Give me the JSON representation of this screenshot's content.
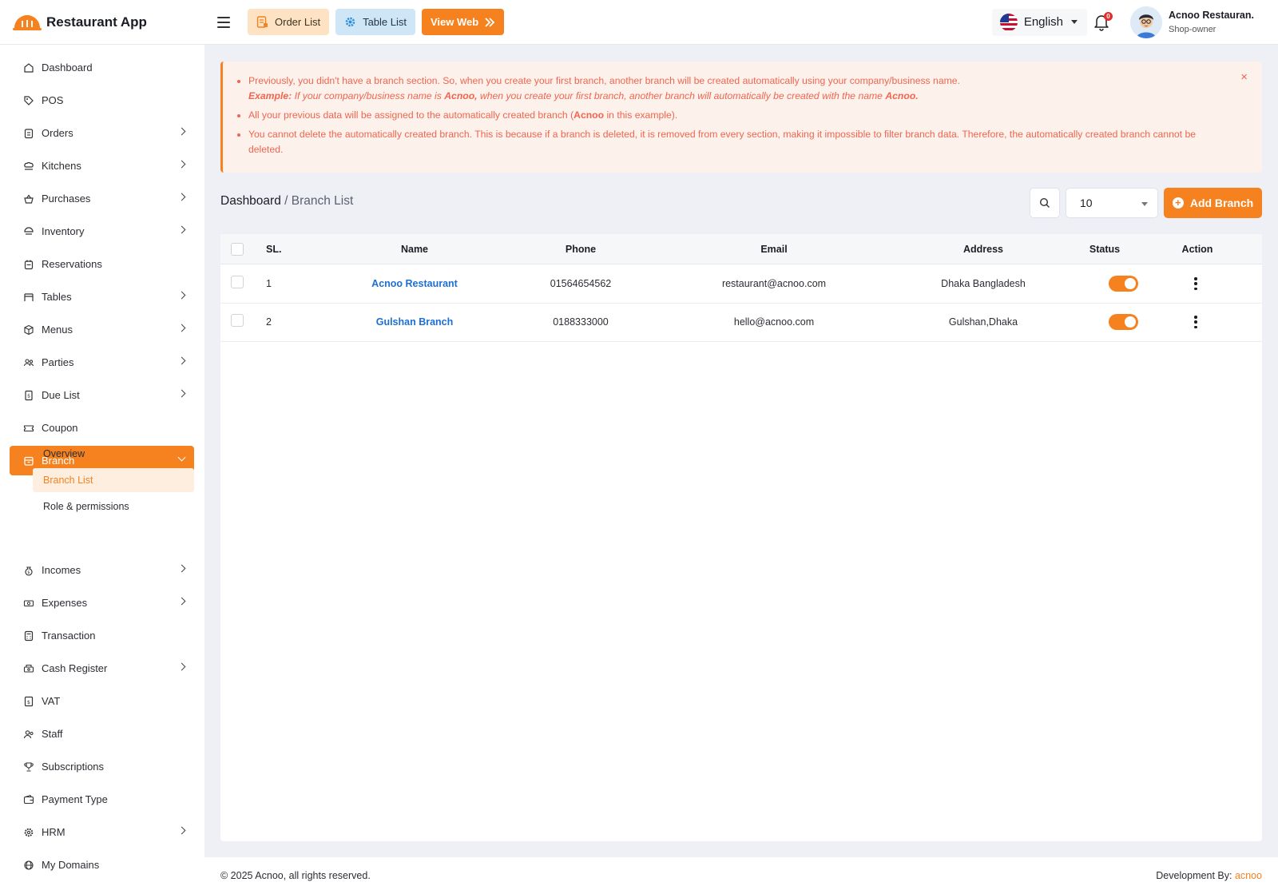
{
  "app": {
    "name": "Restaurant App"
  },
  "header": {
    "order_list": "Order List",
    "table_list": "Table List",
    "view_web": "View Web",
    "language": "English",
    "notification_count": "0",
    "profile_name": "Acnoo Restauran.",
    "profile_role": "Shop-owner"
  },
  "sidebar": {
    "items": [
      {
        "label": "Dashboard",
        "icon": "dashboard-icon",
        "chevron": false
      },
      {
        "label": "POS",
        "icon": "tag-icon",
        "chevron": false
      },
      {
        "label": "Orders",
        "icon": "clipboard-icon",
        "chevron": true
      },
      {
        "label": "Kitchens",
        "icon": "chef-hat-icon",
        "chevron": true
      },
      {
        "label": "Purchases",
        "icon": "basket-icon",
        "chevron": true
      },
      {
        "label": "Inventory",
        "icon": "inventory-icon",
        "chevron": true
      },
      {
        "label": "Reservations",
        "icon": "calendar-icon",
        "chevron": false
      },
      {
        "label": "Tables",
        "icon": "table-icon",
        "chevron": true
      },
      {
        "label": "Menus",
        "icon": "box-icon",
        "chevron": true
      },
      {
        "label": "Parties",
        "icon": "users-icon",
        "chevron": true
      },
      {
        "label": "Due List",
        "icon": "receipt-icon",
        "chevron": true
      },
      {
        "label": "Coupon",
        "icon": "ticket-icon",
        "chevron": false
      },
      {
        "label": "Branch",
        "icon": "store-icon",
        "chevron": true,
        "active": true
      }
    ],
    "branch_sub": [
      "Overview",
      "Branch List",
      "Role & permissions"
    ],
    "items_after": [
      {
        "label": "Incomes",
        "icon": "money-bag-icon",
        "chevron": true
      },
      {
        "label": "Expenses",
        "icon": "cash-icon",
        "chevron": true
      },
      {
        "label": "Transaction",
        "icon": "calculator-icon",
        "chevron": false
      },
      {
        "label": "Cash Register",
        "icon": "register-icon",
        "chevron": true
      },
      {
        "label": "VAT",
        "icon": "vat-icon",
        "chevron": false
      },
      {
        "label": "Staff",
        "icon": "staff-icon",
        "chevron": false
      },
      {
        "label": "Subscriptions",
        "icon": "trophy-icon",
        "chevron": false
      },
      {
        "label": "Payment Type",
        "icon": "wallet-icon",
        "chevron": false
      },
      {
        "label": "HRM",
        "icon": "gear-icon",
        "chevron": true
      },
      {
        "label": "My Domains",
        "icon": "globe-icon",
        "chevron": false
      }
    ]
  },
  "alert": {
    "line1": "Previously, you didn't have a branch section. So, when you create your first branch, another branch will be created automatically using your company/business name.",
    "example_label": "Example:",
    "example_pre": " If your company/business name is ",
    "example_name": "Acnoo,",
    "example_mid": " when you create your first branch, another branch will automatically be created with the name ",
    "example_name2": "Acnoo.",
    "line2_pre": "All your previous data will be assigned to the automatically created branch (",
    "line2_bold": "Acnoo",
    "line2_post": " in this example).",
    "line3": "You cannot delete the automatically created branch. This is because if a branch is deleted, it is removed from every section, making it impossible to filter branch data. Therefore, the automatically created branch cannot be deleted.",
    "close": "×"
  },
  "breadcrumb": {
    "root": "Dashboard",
    "sep": " / ",
    "current": "Branch List"
  },
  "controls": {
    "per_page": "10",
    "add_branch": "Add Branch"
  },
  "table": {
    "headers": {
      "sl": "SL.",
      "name": "Name",
      "phone": "Phone",
      "email": "Email",
      "address": "Address",
      "status": "Status",
      "action": "Action"
    },
    "rows": [
      {
        "sl": "1",
        "name": "Acnoo Restaurant",
        "phone": "01564654562",
        "email": "restaurant@acnoo.com",
        "address": "Dhaka Bangladesh",
        "status": true
      },
      {
        "sl": "2",
        "name": "Gulshan Branch",
        "phone": "0188333000",
        "email": "hello@acnoo.com",
        "address": "Gulshan,Dhaka",
        "status": true
      }
    ]
  },
  "footer": {
    "copyright": "© 2025 Acnoo, all rights reserved.",
    "dev_label": "Development By: ",
    "dev_brand": "acnoo"
  },
  "colors": {
    "accent": "#f5821f",
    "link": "#1c6fd6",
    "alert_text": "#f0654f",
    "alert_bg": "#fdf1ec"
  }
}
